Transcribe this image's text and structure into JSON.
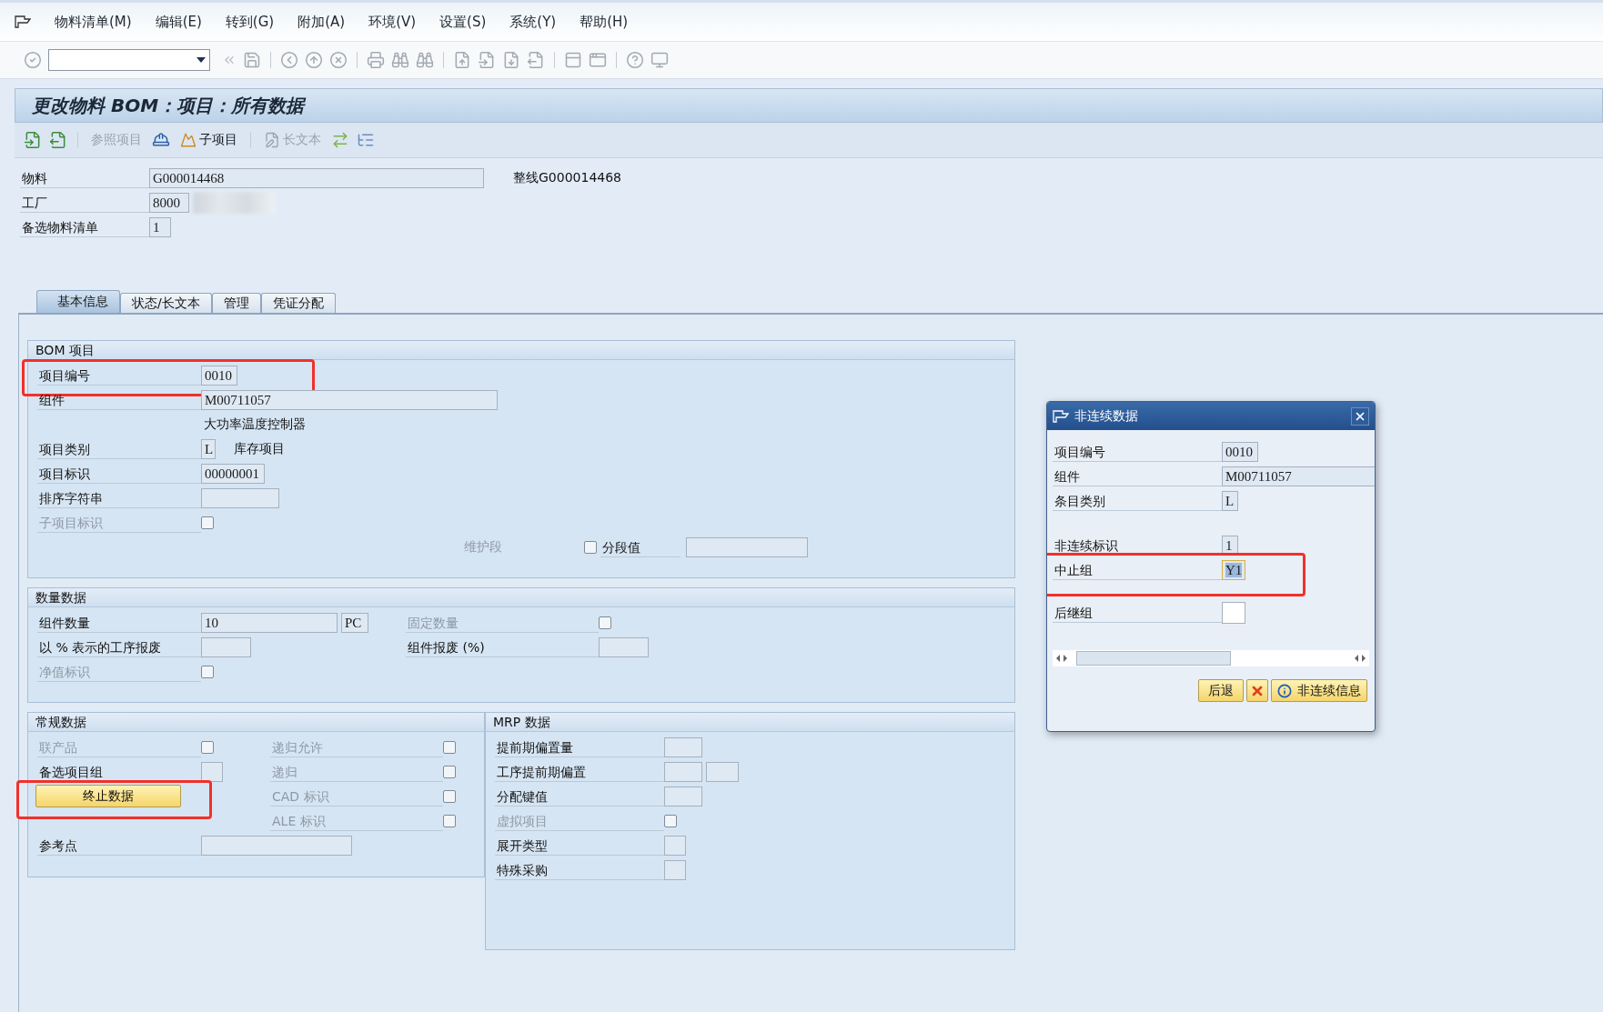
{
  "menu": [
    "物料清单(M)",
    "编辑(E)",
    "转到(G)",
    "附加(A)",
    "环境(V)",
    "设置(S)",
    "系统(Y)",
    "帮助(H)"
  ],
  "title": "更改物料 BOM：项目：所有数据",
  "app_toolbar": [
    {
      "label": "参照项目",
      "disabled": true
    },
    {
      "label": "子项目",
      "disabled": false
    },
    {
      "label": "长文本",
      "disabled": true
    }
  ],
  "header": [
    {
      "label": "物料",
      "value": "G000014468",
      "description": "整线G000014468"
    },
    {
      "label": "工厂",
      "value": "8000",
      "redacted": true
    },
    {
      "label": "备选物料清单",
      "value": "1"
    }
  ],
  "tabs": [
    {
      "label": "基本信息",
      "selected": true
    },
    {
      "label": "状态/长文本",
      "selected": false
    },
    {
      "label": "管理",
      "selected": false
    },
    {
      "label": "凭证分配",
      "selected": false
    }
  ],
  "bom_item": {
    "title": "BOM 项目",
    "rows": [
      {
        "main": {
          "kind": "input",
          "label": "项目编号",
          "value": "0010",
          "disabled": false,
          "annotated": true
        }
      },
      {
        "main": {
          "kind": "input",
          "label": "组件",
          "value": "M00711057",
          "disabled": false
        }
      },
      {
        "main": {
          "kind": "text",
          "text": "大功率温度控制器"
        }
      },
      {
        "main": {
          "kind": "input",
          "label": "项目类别",
          "value": "L",
          "description": "库存项目",
          "disabled": false
        }
      },
      {
        "main": {
          "kind": "input",
          "label": "项目标识",
          "value": "00000001",
          "disabled": false
        }
      },
      {
        "main": {
          "kind": "input",
          "label": "排序字符串",
          "disabled": false
        }
      },
      {
        "main": {
          "kind": "checkbox",
          "label": "子项目标识",
          "disabled": true,
          "checked": false
        }
      },
      {
        "main": {
          "kind": "segment",
          "label": "维护段",
          "disabled": true,
          "checked": false,
          "option_label": "分段值"
        }
      }
    ]
  },
  "quantity": {
    "title": "数量数据",
    "rows": [
      {
        "main": {
          "kind": "input",
          "label": "组件数量",
          "value": "10",
          "unit": "PC",
          "disabled": false
        },
        "side": {
          "kind": "checkbox",
          "label": "固定数量",
          "disabled": true,
          "checked": false
        }
      },
      {
        "main": {
          "kind": "input",
          "label": "以 % 表示的工序报废",
          "disabled": false
        },
        "side": {
          "kind": "input",
          "label": "组件报废 (%)",
          "disabled": false
        }
      },
      {
        "main": {
          "kind": "checkbox",
          "label": "净值标识",
          "disabled": true,
          "checked": false
        }
      }
    ]
  },
  "general": {
    "title": "常规数据",
    "rows": [
      {
        "main": {
          "kind": "checkbox",
          "label": "联产品",
          "disabled": true,
          "checked": false
        },
        "side": {
          "kind": "checkbox",
          "label": "递归允许",
          "disabled": true,
          "checked": false
        }
      },
      {
        "main": {
          "kind": "input",
          "label": "备选项目组",
          "disabled": false
        },
        "side": {
          "kind": "checkbox",
          "label": "递归",
          "disabled": true,
          "checked": false
        }
      },
      {
        "main": {
          "kind": "button",
          "label": "终止数据",
          "annotated": true
        },
        "side": {
          "kind": "checkbox",
          "label": "CAD 标识",
          "disabled": true,
          "checked": false
        }
      },
      {
        "side": {
          "kind": "checkbox",
          "label": "ALE 标识",
          "disabled": true,
          "checked": false
        }
      },
      {
        "main": {
          "kind": "input",
          "label": "参考点",
          "disabled": false
        }
      }
    ]
  },
  "mrp": {
    "title": "MRP 数据",
    "rows": [
      {
        "main": {
          "kind": "input",
          "label": "提前期偏置量",
          "disabled": false
        }
      },
      {
        "main": {
          "kind": "input",
          "label": "工序提前期偏置",
          "disabled": false
        }
      },
      {
        "main": {
          "kind": "input",
          "label": "分配键值",
          "disabled": false
        }
      },
      {
        "main": {
          "kind": "checkbox",
          "label": "虚拟项目",
          "disabled": true,
          "checked": false
        }
      },
      {
        "main": {
          "kind": "input",
          "label": "展开类型",
          "disabled": false
        }
      },
      {
        "main": {
          "kind": "input",
          "label": "特殊采购",
          "disabled": false
        }
      }
    ]
  },
  "dialog": {
    "title": "非连续数据",
    "rows": [
      {
        "label": "项目编号",
        "value": "0010",
        "editable": false,
        "focused": false
      },
      {
        "label": "组件",
        "value": "M00711057",
        "editable": false,
        "focused": false
      },
      {
        "label": "条目类别",
        "value": "L",
        "editable": false,
        "focused": false
      },
      {
        "label": "非连续标识",
        "value": "1",
        "editable": false,
        "focused": false
      },
      {
        "label": "中止组",
        "value": "Y1",
        "editable": true,
        "focused": true,
        "annotated": true
      },
      {
        "label": "后继组",
        "editable": true,
        "focused": false
      }
    ],
    "buttons": [
      {
        "kind": "text",
        "label": "后退"
      },
      {
        "kind": "cancel"
      },
      {
        "kind": "info",
        "label": "非连续信息"
      }
    ]
  }
}
